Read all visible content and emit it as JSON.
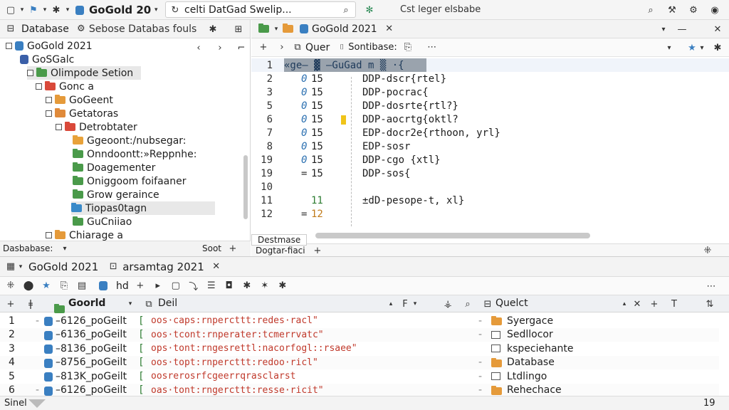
{
  "topbar": {
    "project_name": "GoGold 20",
    "search_text": "celti  DatGad Swelip...",
    "right_label": "Cst leger elsbabe"
  },
  "left_panel": {
    "tab_database": "Database",
    "tab_browse": "Sebose Databas fouls",
    "tree": [
      {
        "label": "GoGold 2021",
        "color": "#3a7fc1",
        "kind": "db"
      },
      {
        "label": "GoSGalc",
        "color": "#3a5fa8",
        "kind": "db"
      },
      {
        "label": "Olimpode Setion",
        "color": "#4a9a4a",
        "kind": "folder"
      },
      {
        "label": "Gonc a",
        "color": "#d9493a",
        "kind": "folder"
      },
      {
        "label": "GoGeent",
        "color": "#e59a3a",
        "kind": "folder"
      },
      {
        "label": "Getatoras",
        "color": "#e08a3a",
        "kind": "folder"
      },
      {
        "label": "Detrobtater",
        "color": "#d9493a",
        "kind": "folder"
      },
      {
        "label": "Ggeoont:/nubsegar:",
        "color": "#e8a23a",
        "kind": "folder"
      },
      {
        "label": "Onndoontt:»Reppnhe:",
        "color": "#4a9a4a",
        "kind": "folder"
      },
      {
        "label": "Doagementer",
        "color": "#4a9a4a",
        "kind": "folder"
      },
      {
        "label": "Oniggoom foifaaner",
        "color": "#4a9a4a",
        "kind": "folder"
      },
      {
        "label": "Grow geraince",
        "color": "#4a9a4a",
        "kind": "folder"
      },
      {
        "label": "Tiopas0tagn",
        "color": "#3a8ac9",
        "kind": "folder"
      },
      {
        "label": "GuCniiao",
        "color": "#4a9a4a",
        "kind": "folder"
      },
      {
        "label": "Chiarage a",
        "color": "#e59a3a",
        "kind": "folder"
      }
    ],
    "footer_left": "Dasbabase:",
    "footer_right": "Soot"
  },
  "editor": {
    "tab_label": "GoGold 2021",
    "sub_query": "Quer",
    "sub_connection": "Sontibase:",
    "lines": [
      {
        "num": "1",
        "a": "",
        "b": "",
        "code": "«ge— ▓  —GuGad m ▒ ·{"
      },
      {
        "num": "2",
        "a": "0",
        "b": "15",
        "code": "DDP-dscr{rtel}"
      },
      {
        "num": "3",
        "a": "0",
        "b": "15",
        "code": "DDP-pocrac{"
      },
      {
        "num": "5",
        "a": "0",
        "b": "15",
        "code": "DDP-dosrte{rtl?}"
      },
      {
        "num": "6",
        "a": "0",
        "b": "15",
        "code": "DDP-aocrtg{oktl?"
      },
      {
        "num": "7",
        "a": "0",
        "b": "15",
        "code": "EDP-docr2e{rthoon, yrl}"
      },
      {
        "num": "8",
        "a": "0",
        "b": "15",
        "code": "EDP-sosr"
      },
      {
        "num": "19",
        "a": "0",
        "b": "15",
        "code": "DDP-cgo {xtl}"
      },
      {
        "num": "19",
        "a": "=",
        "b": "15",
        "code": "DDP-sos{"
      },
      {
        "num": "10",
        "a": "",
        "b": "",
        "code": ""
      },
      {
        "num": "11",
        "a": "",
        "b": "11",
        "code": "±dD-pesope-t, xl}"
      },
      {
        "num": "12",
        "a": "=",
        "b": "12",
        "code": ""
      }
    ],
    "footer_tab": "Destmase",
    "footer_label": "Dogtar-fiaci"
  },
  "bottom": {
    "tab1": "GoGold 2021",
    "tab2": "arsamtag 2021",
    "tool_label": "hd",
    "col1": "Goorld",
    "col2": "Deil",
    "col3": "Quelct",
    "rows": [
      {
        "n": "1",
        "id": "–6126_poGeilt",
        "val": "oos·caps:rnpercttt:redes·racl\"",
        "obj": "Syergace"
      },
      {
        "n": "2",
        "id": "–6136_poGeilt",
        "val": "oos·tcont:rnperater:tcmerrvatc\"",
        "obj": "Sedllocor"
      },
      {
        "n": "3",
        "id": "–8136_poGeilt",
        "val": "ops·tont:rngesrettl:nacorfogl::rsaee\"",
        "obj": "kspeciehante"
      },
      {
        "n": "4",
        "id": "–8756_poGeilt",
        "val": "oos·topt:rnpercttt:redoo·ricl\"",
        "obj": "Database"
      },
      {
        "n": "5",
        "id": "–813K_poGeilt",
        "val": "oosrerosrfcgeerrqrasclarst",
        "obj": "Ltdlingo"
      },
      {
        "n": "6",
        "id": "–6126_poGeilt",
        "val": "oas·tont:rngercttt:resse·ricit\"",
        "obj": "Rehechace"
      }
    ],
    "status_left": "Sinel",
    "status_right": "19"
  }
}
